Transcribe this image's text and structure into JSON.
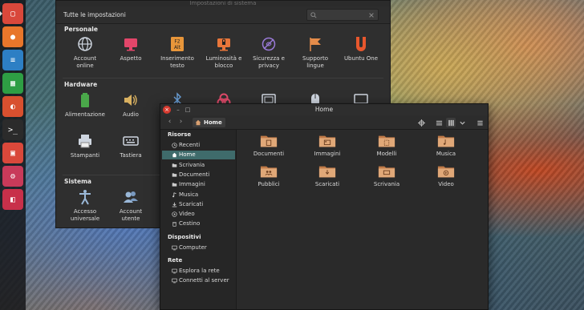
{
  "settings_window": {
    "title": "Impostazioni di sistema",
    "all_settings_label": "Tutte le impostazioni",
    "sections": [
      {
        "title": "Personale",
        "items": [
          {
            "label": "Account\nonline",
            "icon": "accounts-icon"
          },
          {
            "label": "Aspetto",
            "icon": "appearance-icon"
          },
          {
            "label": "Inserimento\ntesto",
            "icon": "text-input-icon",
            "icon_text": "F2\nAlt"
          },
          {
            "label": "Luminosità e\nblocco",
            "icon": "brightness-lock-icon"
          },
          {
            "label": "Sicurezza e\nprivacy",
            "icon": "privacy-icon"
          },
          {
            "label": "Supporto\nlingue",
            "icon": "language-flag-icon"
          },
          {
            "label": "Ubuntu One",
            "icon": "ubuntu-one-icon"
          }
        ]
      },
      {
        "title": "Hardware",
        "items": [
          {
            "label": "Alimentazione",
            "icon": "battery-icon"
          },
          {
            "label": "Audio",
            "icon": "speaker-icon"
          },
          {
            "label": "",
            "icon": "bluetooth-icon"
          },
          {
            "label": "",
            "icon": "color-icon"
          },
          {
            "label": "",
            "icon": "display-icon"
          },
          {
            "label": "",
            "icon": "mouse-icon"
          },
          {
            "label": "",
            "icon": "monitor-icon"
          },
          {
            "label": "Stampanti",
            "icon": "printer-icon"
          },
          {
            "label": "Tastiera",
            "icon": "keyboard-icon"
          }
        ]
      },
      {
        "title": "Sistema",
        "items": [
          {
            "label": "Accesso\nuniversale",
            "icon": "accessibility-icon"
          },
          {
            "label": "Account\nutente",
            "icon": "users-icon"
          }
        ]
      }
    ]
  },
  "files_window": {
    "title": "Home",
    "path_button": "Home",
    "sidebar": {
      "sections": [
        {
          "title": "Risorse",
          "items": [
            {
              "label": "Recenti",
              "icon": "clock-icon",
              "selected": false
            },
            {
              "label": "Home",
              "icon": "home-icon",
              "selected": true
            },
            {
              "label": "Scrivania",
              "icon": "folder-icon",
              "selected": false
            },
            {
              "label": "Documenti",
              "icon": "folder-icon",
              "selected": false
            },
            {
              "label": "Immagini",
              "icon": "folder-icon",
              "selected": false
            },
            {
              "label": "Musica",
              "icon": "music-icon",
              "selected": false
            },
            {
              "label": "Scaricati",
              "icon": "download-icon",
              "selected": false
            },
            {
              "label": "Video",
              "icon": "video-icon",
              "selected": false
            },
            {
              "label": "Cestino",
              "icon": "trash-icon",
              "selected": false
            }
          ]
        },
        {
          "title": "Dispositivi",
          "items": [
            {
              "label": "Computer",
              "icon": "computer-icon",
              "selected": false
            }
          ]
        },
        {
          "title": "Rete",
          "items": [
            {
              "label": "Esplora la rete",
              "icon": "network-icon",
              "selected": false
            },
            {
              "label": "Connetti al server",
              "icon": "server-icon",
              "selected": false
            }
          ]
        }
      ]
    },
    "folders": [
      {
        "label": "Documenti",
        "emblem": "document"
      },
      {
        "label": "Immagini",
        "emblem": "image"
      },
      {
        "label": "Modelli",
        "emblem": "template"
      },
      {
        "label": "Musica",
        "emblem": "music"
      },
      {
        "label": "Pubblici",
        "emblem": "people"
      },
      {
        "label": "Scaricati",
        "emblem": "download"
      },
      {
        "label": "Scrivania",
        "emblem": "desktop"
      },
      {
        "label": "Video",
        "emblem": "video"
      }
    ]
  },
  "launcher": {
    "items": [
      {
        "name": "files-launcher-icon",
        "color": "#d9483b"
      },
      {
        "name": "firefox-launcher-icon",
        "color": "#e8762b"
      },
      {
        "name": "writer-launcher-icon",
        "color": "#2d7fc4"
      },
      {
        "name": "calc-launcher-icon",
        "color": "#2e9e44"
      },
      {
        "name": "impress-launcher-icon",
        "color": "#d8502f"
      },
      {
        "name": "terminal-launcher-icon",
        "color": "#2b2b2b"
      },
      {
        "name": "software-center-launcher-icon",
        "color": "#d9483b"
      },
      {
        "name": "settings-launcher-icon",
        "color": "#c83a5a"
      },
      {
        "name": "switch-launcher-icon",
        "color": "#c8304a"
      }
    ]
  },
  "colors": {
    "accent_selection": "#3f6b6b",
    "folder": "#d9a070",
    "window_bg": "#2f2f2f"
  }
}
